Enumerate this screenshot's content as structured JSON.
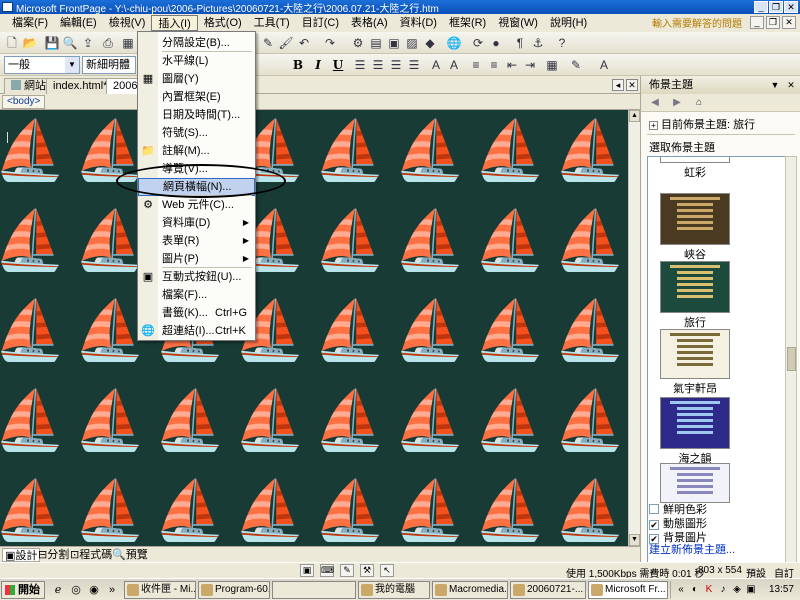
{
  "window": {
    "title": "Microsoft FrontPage - Y:\\-chiu-pou\\2006-Pictures\\20060721-大陸之行\\2006.07.21-大陸之行.htm"
  },
  "menubar": {
    "items": [
      "檔案(F)",
      "編輯(E)",
      "檢視(V)",
      "插入(I)",
      "格式(O)",
      "工具(T)",
      "目訂(C)",
      "表格(A)",
      "資料(D)",
      "框架(R)",
      "視窗(W)",
      "說明(H)"
    ],
    "help_box": "輸入需要解答的問題"
  },
  "toolbar": {
    "style_value": "一般",
    "font_value": "新細明體",
    "format_buttons": [
      "B",
      "I",
      "U"
    ]
  },
  "tabs": {
    "site": "網站",
    "file1": "index.html*",
    "file2": "2006.07..."
  },
  "tagbar": {
    "tag": "<body>"
  },
  "insert_menu": {
    "items": [
      {
        "label": "分隔設定(B)...",
        "icon": ""
      },
      {
        "label": "水平線(L)",
        "icon": ""
      },
      {
        "label": "圖層(Y)",
        "icon": "layer-icon"
      },
      {
        "label": "內置框架(E)",
        "icon": ""
      },
      {
        "label": "日期及時間(T)...",
        "icon": ""
      },
      {
        "label": "符號(S)...",
        "icon": ""
      },
      {
        "label": "註解(M)...",
        "icon": "comment-icon"
      },
      {
        "label": "導覽(V)...",
        "icon": ""
      },
      {
        "label": "網頁橫幅(N)...",
        "icon": ""
      },
      {
        "label": "Web 元件(C)...",
        "icon": "web-component-icon"
      },
      {
        "label": "資料庫(D)",
        "icon": "",
        "submenu": true
      },
      {
        "label": "表單(R)",
        "icon": "",
        "submenu": true
      },
      {
        "label": "圖片(P)",
        "icon": "",
        "submenu": true
      },
      {
        "label": "互動式按鈕(U)...",
        "icon": "interactive-button-icon"
      },
      {
        "label": "檔案(F)...",
        "icon": ""
      },
      {
        "label": "書籤(K)...",
        "icon": "",
        "shortcut": "Ctrl+G"
      },
      {
        "label": "超連結(I)...",
        "icon": "hyperlink-icon",
        "shortcut": "Ctrl+K"
      }
    ]
  },
  "view_tabs": [
    "設計",
    "分割",
    "程式碼",
    "預覽"
  ],
  "task_pane": {
    "title": "佈景主題",
    "current_theme": "目前佈景主題: 旅行",
    "select_label": "選取佈景主題",
    "themes": [
      {
        "name": "虹彩",
        "colors": [
          "#ffffff",
          "#6b4a8a"
        ]
      },
      {
        "name": "峽谷",
        "colors": [
          "#4a3a22",
          "#c9a86a"
        ]
      },
      {
        "name": "旅行",
        "colors": [
          "#1c4a3c",
          "#d8c070"
        ]
      },
      {
        "name": "氣宇軒昂",
        "colors": [
          "#f4f1e2",
          "#7a6a3a"
        ]
      },
      {
        "name": "海之韻",
        "colors": [
          "#2d2a8a",
          "#9ec8f0"
        ]
      },
      {
        "name": "",
        "colors": [
          "#f2f2fa",
          "#8888bb"
        ]
      }
    ],
    "checks": [
      {
        "label": "鮮明色彩",
        "checked": false
      },
      {
        "label": "動態圖形",
        "checked": true
      },
      {
        "label": "背景圖片",
        "checked": true
      }
    ],
    "create_link": "建立新佈景主題..."
  },
  "statusbar": {
    "speed": "使用 1,500Kbps 需費時 0:01 秒",
    "size": "803 x 554",
    "mode1": "預設",
    "mode2": "自訂"
  },
  "taskbar": {
    "start": "開始",
    "tasks": [
      "收件匣 - Mi...",
      "Program-60...",
      "我的電腦",
      "Macromedia...",
      "20060721-...",
      "Microsoft Fr..."
    ],
    "clock": "13:57"
  }
}
